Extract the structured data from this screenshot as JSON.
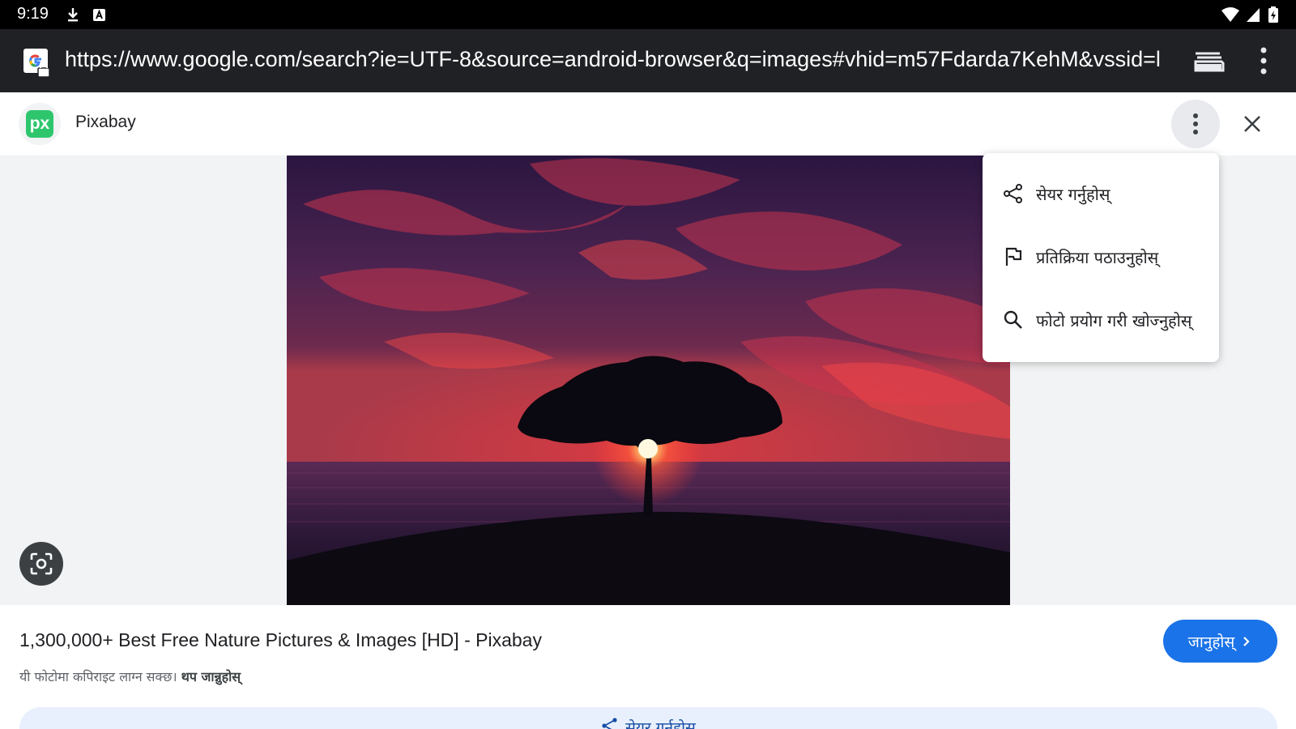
{
  "status_bar": {
    "time": "9:19",
    "icons": [
      "download-icon",
      "a-icon",
      "wifi-icon",
      "signal-icon",
      "battery-icon"
    ]
  },
  "browser": {
    "url": "https://www.google.com/search?ie=UTF-8&source=android-browser&q=images#vhid=m57Fdarda7KehM&vssid=l",
    "icons": [
      "google-secure-icon",
      "tabs-icon",
      "overflow-menu-icon"
    ]
  },
  "header": {
    "source_logo_text": "px",
    "source_name": "Pixabay"
  },
  "menu": {
    "items": [
      {
        "label": "सेयर गर्नुहोस्",
        "icon": "share-icon"
      },
      {
        "label": "प्रतिक्रिया पठाउनुहोस्",
        "icon": "flag-icon"
      },
      {
        "label": "फोटो प्रयोग गरी खोज्नुहोस्",
        "icon": "search-icon"
      }
    ]
  },
  "result": {
    "title": "1,300,000+ Best Free Nature Pictures & Images [HD] - Pixabay",
    "copyright_text": "यी फोटोमा कपिराइट लाग्न सक्छ।",
    "learn_more": "थप जान्नुहोस्",
    "visit_label": "जानुहोस्",
    "share_label": "सेयर गर्नुहोस्"
  },
  "colors": {
    "accent": "#1a73e8",
    "url_bar": "#202124",
    "pixabay_green": "#2ec66d"
  }
}
